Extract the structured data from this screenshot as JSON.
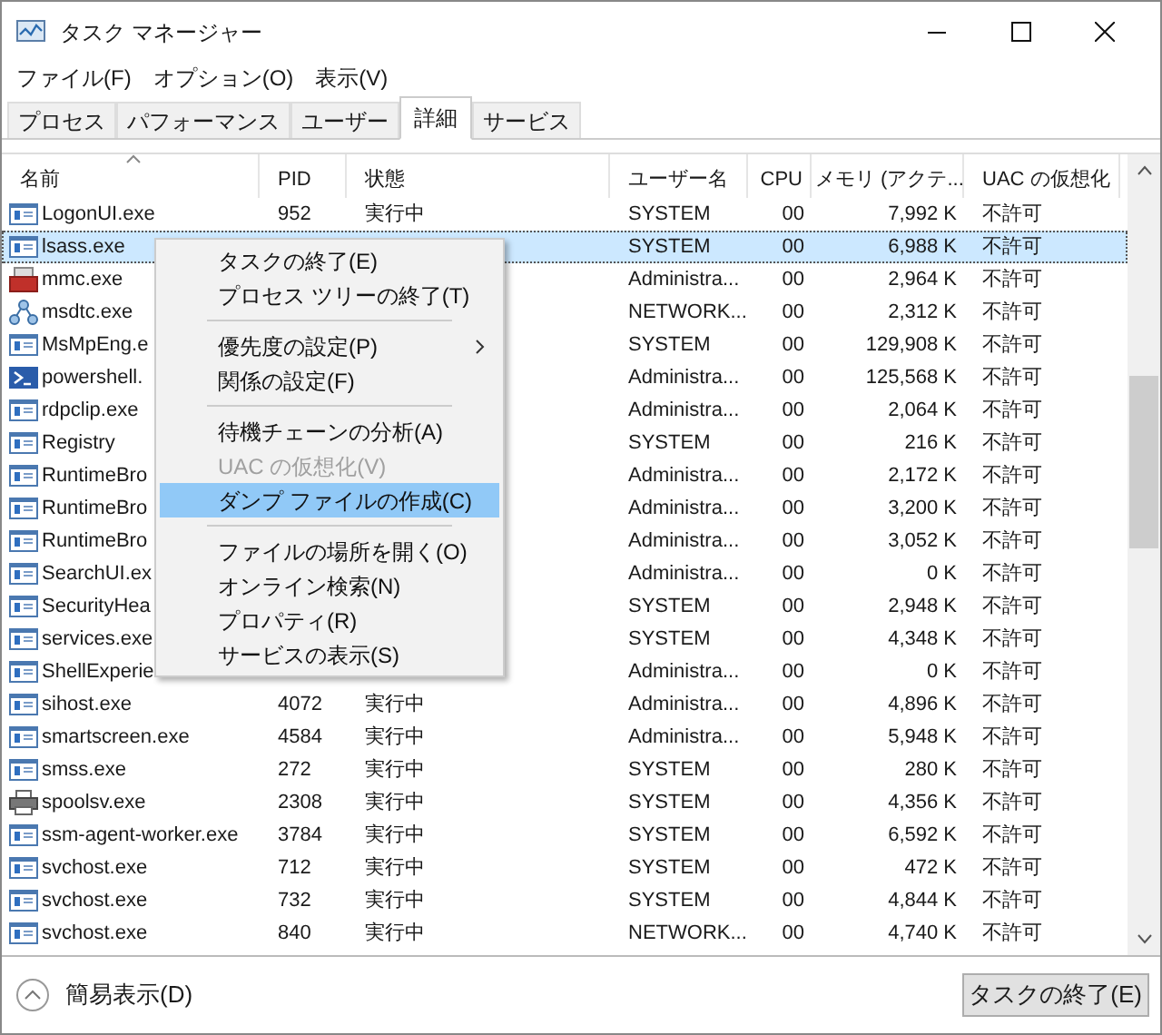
{
  "window": {
    "title": "タスク マネージャー"
  },
  "menu_bar": [
    "ファイル(F)",
    "オプション(O)",
    "表示(V)"
  ],
  "tabs": [
    {
      "label": "プロセス",
      "selected": false
    },
    {
      "label": "パフォーマンス",
      "selected": false
    },
    {
      "label": "ユーザー",
      "selected": false
    },
    {
      "label": "詳細",
      "selected": true
    },
    {
      "label": "サービス",
      "selected": false
    }
  ],
  "table": {
    "columns": [
      {
        "label": "名前",
        "sorted": true
      },
      {
        "label": "PID"
      },
      {
        "label": "状態"
      },
      {
        "label": "ユーザー名"
      },
      {
        "label": "CPU"
      },
      {
        "label": "メモリ (アクテ..."
      },
      {
        "label": "UAC の仮想化"
      }
    ],
    "rows": [
      {
        "kind": "app",
        "name": "LogonUI.exe",
        "pid": "952",
        "status": "実行中",
        "user": "SYSTEM",
        "cpu": "00",
        "memory": "7,992 K",
        "uac": "不許可",
        "selected": false
      },
      {
        "kind": "app",
        "name": "lsass.exe",
        "user": "SYSTEM",
        "cpu": "00",
        "memory": "6,988 K",
        "uac": "不許可",
        "selected": true
      },
      {
        "kind": "toolbox",
        "name": "mmc.exe",
        "user": "Administra...",
        "cpu": "00",
        "memory": "2,964 K",
        "uac": "不許可",
        "selected": false
      },
      {
        "kind": "network",
        "name": "msdtc.exe",
        "user": "NETWORK...",
        "cpu": "00",
        "memory": "2,312 K",
        "uac": "不許可",
        "selected": false
      },
      {
        "kind": "app",
        "name": "MsMpEng.e",
        "user": "SYSTEM",
        "cpu": "00",
        "memory": "129,908 K",
        "uac": "不許可",
        "selected": false
      },
      {
        "kind": "shell",
        "name": "powershell.",
        "user": "Administra...",
        "cpu": "00",
        "memory": "125,568 K",
        "uac": "不許可",
        "selected": false
      },
      {
        "kind": "app",
        "name": "rdpclip.exe",
        "user": "Administra...",
        "cpu": "00",
        "memory": "2,064 K",
        "uac": "不許可",
        "selected": false
      },
      {
        "kind": "app",
        "name": "Registry",
        "user": "SYSTEM",
        "cpu": "00",
        "memory": "216 K",
        "uac": "不許可",
        "selected": false
      },
      {
        "kind": "app",
        "name": "RuntimeBro",
        "user": "Administra...",
        "cpu": "00",
        "memory": "2,172 K",
        "uac": "不許可",
        "selected": false
      },
      {
        "kind": "app",
        "name": "RuntimeBro",
        "user": "Administra...",
        "cpu": "00",
        "memory": "3,200 K",
        "uac": "不許可",
        "selected": false
      },
      {
        "kind": "app",
        "name": "RuntimeBro",
        "user": "Administra...",
        "cpu": "00",
        "memory": "3,052 K",
        "uac": "不許可",
        "selected": false
      },
      {
        "kind": "app",
        "name": "SearchUI.ex",
        "user": "Administra...",
        "cpu": "00",
        "memory": "0 K",
        "uac": "不許可",
        "selected": false
      },
      {
        "kind": "app",
        "name": "SecurityHea",
        "user": "SYSTEM",
        "cpu": "00",
        "memory": "2,948 K",
        "uac": "不許可",
        "selected": false
      },
      {
        "kind": "app",
        "name": "services.exe",
        "user": "SYSTEM",
        "cpu": "00",
        "memory": "4,348 K",
        "uac": "不許可",
        "selected": false
      },
      {
        "kind": "app",
        "name": "ShellExperie",
        "user": "Administra...",
        "cpu": "00",
        "memory": "0 K",
        "uac": "不許可",
        "selected": false
      },
      {
        "kind": "app",
        "name": "sihost.exe",
        "pid": "4072",
        "status": "実行中",
        "user": "Administra...",
        "cpu": "00",
        "memory": "4,896 K",
        "uac": "不許可",
        "selected": false
      },
      {
        "kind": "app",
        "name": "smartscreen.exe",
        "pid": "4584",
        "status": "実行中",
        "user": "Administra...",
        "cpu": "00",
        "memory": "5,948 K",
        "uac": "不許可",
        "selected": false
      },
      {
        "kind": "app",
        "name": "smss.exe",
        "pid": "272",
        "status": "実行中",
        "user": "SYSTEM",
        "cpu": "00",
        "memory": "280 K",
        "uac": "不許可",
        "selected": false
      },
      {
        "kind": "printer",
        "name": "spoolsv.exe",
        "pid": "2308",
        "status": "実行中",
        "user": "SYSTEM",
        "cpu": "00",
        "memory": "4,356 K",
        "uac": "不許可",
        "selected": false
      },
      {
        "kind": "app",
        "name": "ssm-agent-worker.exe",
        "pid": "3784",
        "status": "実行中",
        "user": "SYSTEM",
        "cpu": "00",
        "memory": "6,592 K",
        "uac": "不許可",
        "selected": false
      },
      {
        "kind": "app",
        "name": "svchost.exe",
        "pid": "712",
        "status": "実行中",
        "user": "SYSTEM",
        "cpu": "00",
        "memory": "472 K",
        "uac": "不許可",
        "selected": false
      },
      {
        "kind": "app",
        "name": "svchost.exe",
        "pid": "732",
        "status": "実行中",
        "user": "SYSTEM",
        "cpu": "00",
        "memory": "4,844 K",
        "uac": "不許可",
        "selected": false
      },
      {
        "kind": "app",
        "name": "svchost.exe",
        "pid": "840",
        "status": "実行中",
        "user": "NETWORK...",
        "cpu": "00",
        "memory": "4,740 K",
        "uac": "不許可",
        "selected": false
      }
    ]
  },
  "context_menu": [
    {
      "kind": "item",
      "label": "タスクの終了(E)",
      "disabled": false,
      "selected": false
    },
    {
      "kind": "item",
      "label": "プロセス ツリーの終了(T)",
      "disabled": false,
      "selected": false
    },
    {
      "kind": "separator"
    },
    {
      "kind": "item",
      "label": "優先度の設定(P)",
      "disabled": false,
      "selected": false,
      "submenu": true
    },
    {
      "kind": "item",
      "label": "関係の設定(F)",
      "disabled": false,
      "selected": false
    },
    {
      "kind": "separator"
    },
    {
      "kind": "item",
      "label": "待機チェーンの分析(A)",
      "disabled": false,
      "selected": false
    },
    {
      "kind": "item",
      "label": "UAC の仮想化(V)",
      "disabled": true,
      "selected": false
    },
    {
      "kind": "item",
      "label": "ダンプ ファイルの作成(C)",
      "disabled": false,
      "selected": true
    },
    {
      "kind": "separator"
    },
    {
      "kind": "item",
      "label": "ファイルの場所を開く(O)",
      "disabled": false,
      "selected": false
    },
    {
      "kind": "item",
      "label": "オンライン検索(N)",
      "disabled": false,
      "selected": false
    },
    {
      "kind": "item",
      "label": "プロパティ(R)",
      "disabled": false,
      "selected": false
    },
    {
      "kind": "item",
      "label": "サービスの表示(S)",
      "disabled": false,
      "selected": false
    }
  ],
  "footer": {
    "toggle_label": "簡易表示(D)",
    "end_task_button": "タスクの終了(E)"
  }
}
